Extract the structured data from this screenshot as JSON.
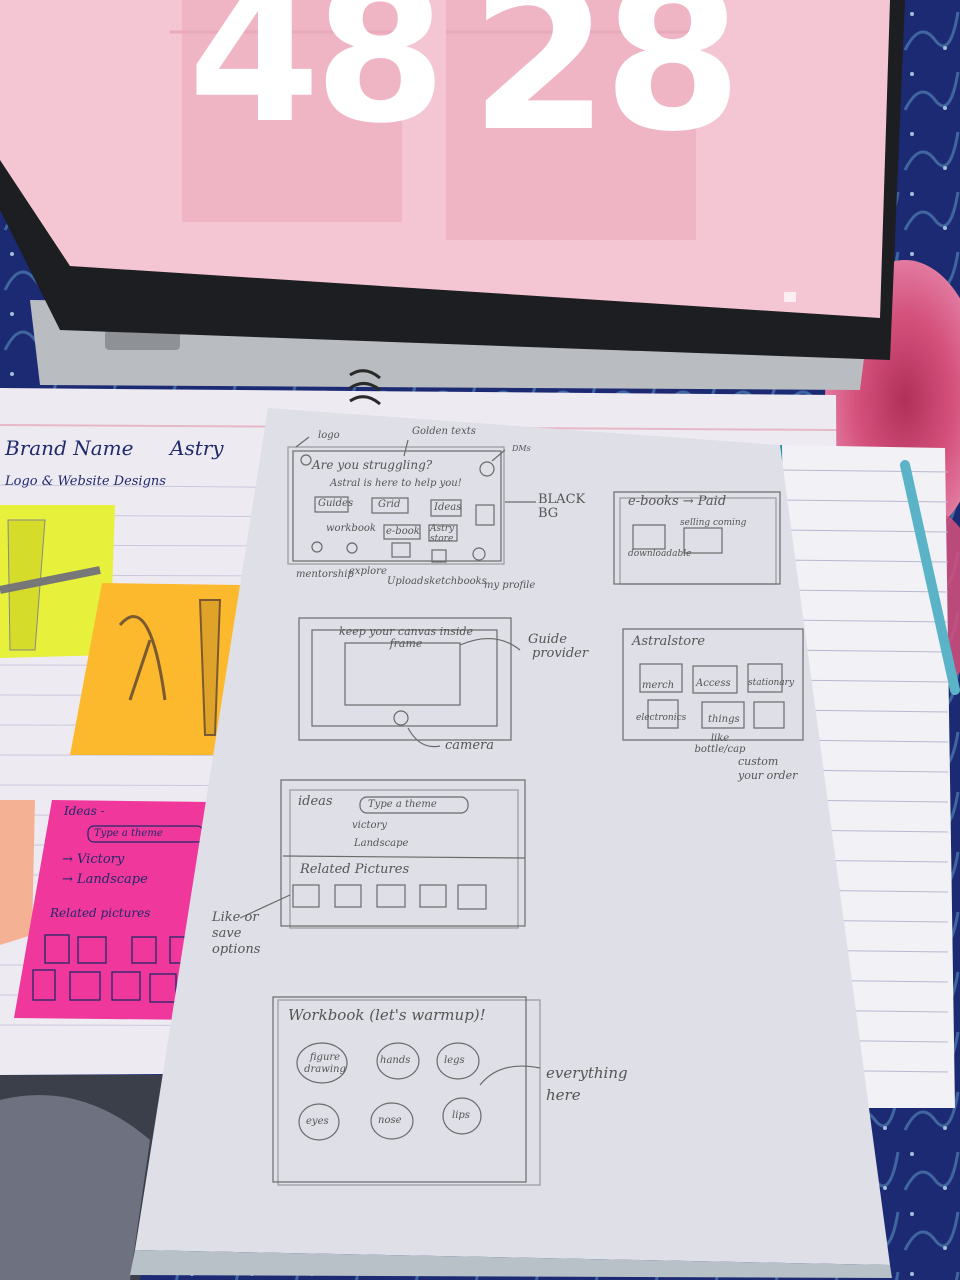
{
  "screen": {
    "clock_hours": "48",
    "clock_minutes": "28",
    "colors": {
      "screen_bg": "#f4c6d3",
      "digit": "#ffffff",
      "card": "#efb5c5"
    }
  },
  "notebook": {
    "brand_label": "Brand Name",
    "brand_value": "Astry",
    "subtitle": "Logo & Website Designs",
    "sticky_pink": {
      "title": "Ideas -",
      "search": "Type a theme",
      "item1": "→ Victory",
      "item2": "→ Landscape",
      "related": "Related pictures"
    }
  },
  "sketch": {
    "home": {
      "note_logo": "logo",
      "note_golden": "Golden texts",
      "note_dms": "DMs",
      "headline": "Are you struggling?",
      "subline": "Astral is here to help you!",
      "note_bg": "BLACK BG",
      "tile1": "Guides",
      "tile2": "Grid",
      "tile3": "Ideas",
      "tile4": "workbook",
      "tile5": "e-book",
      "tile6": "Astry store",
      "nav1": "mentorship",
      "nav2": "explore",
      "nav3": "Upload",
      "nav4": "sketchbooks",
      "nav5": "my profile"
    },
    "ebooks": {
      "title": "e-books → Paid",
      "note1": "selling coming",
      "note2": "downloadable"
    },
    "canvas": {
      "title": "keep your canvas inside frame",
      "note_guide": "Guide",
      "note_provider": "provider",
      "note_camera": "camera"
    },
    "store": {
      "title": "Astralstore",
      "cell1": "merch",
      "cell2": "Access",
      "cell3": "stationary",
      "cell4": "electronics",
      "cell5": "things",
      "note_like": "like bottle/cap",
      "note_custom": "custom your order"
    },
    "ideas": {
      "title": "ideas",
      "search": "Type a theme",
      "item1": "victory",
      "item2": "Landscape",
      "related": "Related Pictures",
      "note_like": "Like or save options"
    },
    "workbook": {
      "title": "Workbook (let's warmup)!",
      "c1": "figure drawing",
      "c2": "hands",
      "c3": "legs",
      "c4": "eyes",
      "c5": "nose",
      "c6": "lips",
      "note": "everything here"
    }
  }
}
